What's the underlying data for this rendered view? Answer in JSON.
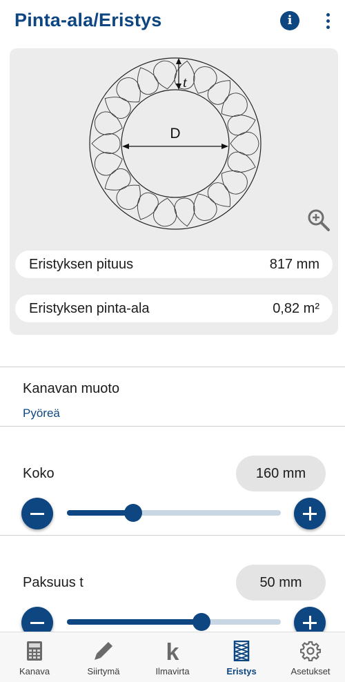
{
  "header": {
    "title": "Pinta-ala/Eristys",
    "info_icon": "info-icon",
    "menu_icon": "more-vertical-icon",
    "accent_color": "#0d4680"
  },
  "diagram": {
    "diameter_label": "D",
    "thickness_label": "t",
    "zoom_icon": "zoom-in-icon"
  },
  "results": [
    {
      "label": "Eristyksen pituus",
      "value": "817 mm"
    },
    {
      "label": "Eristyksen pinta-ala",
      "value": "0,82 m²"
    }
  ],
  "shape": {
    "label": "Kanavan muoto",
    "value": "Pyöreä"
  },
  "size": {
    "label": "Koko",
    "value": "160 mm",
    "slider_fraction": 0.31
  },
  "thickness": {
    "label": "Paksuus t",
    "value": "50 mm",
    "slider_fraction": 0.63
  },
  "bottom_nav": {
    "items": [
      {
        "label": "Kanava",
        "icon": "calculator-icon"
      },
      {
        "label": "Siirtymä",
        "icon": "pencil-icon"
      },
      {
        "label": "Ilmavirta",
        "icon": "k-letter-icon"
      },
      {
        "label": "Eristys",
        "icon": "insulation-coil-icon",
        "active": true
      },
      {
        "label": "Asetukset",
        "icon": "gear-icon"
      }
    ]
  }
}
